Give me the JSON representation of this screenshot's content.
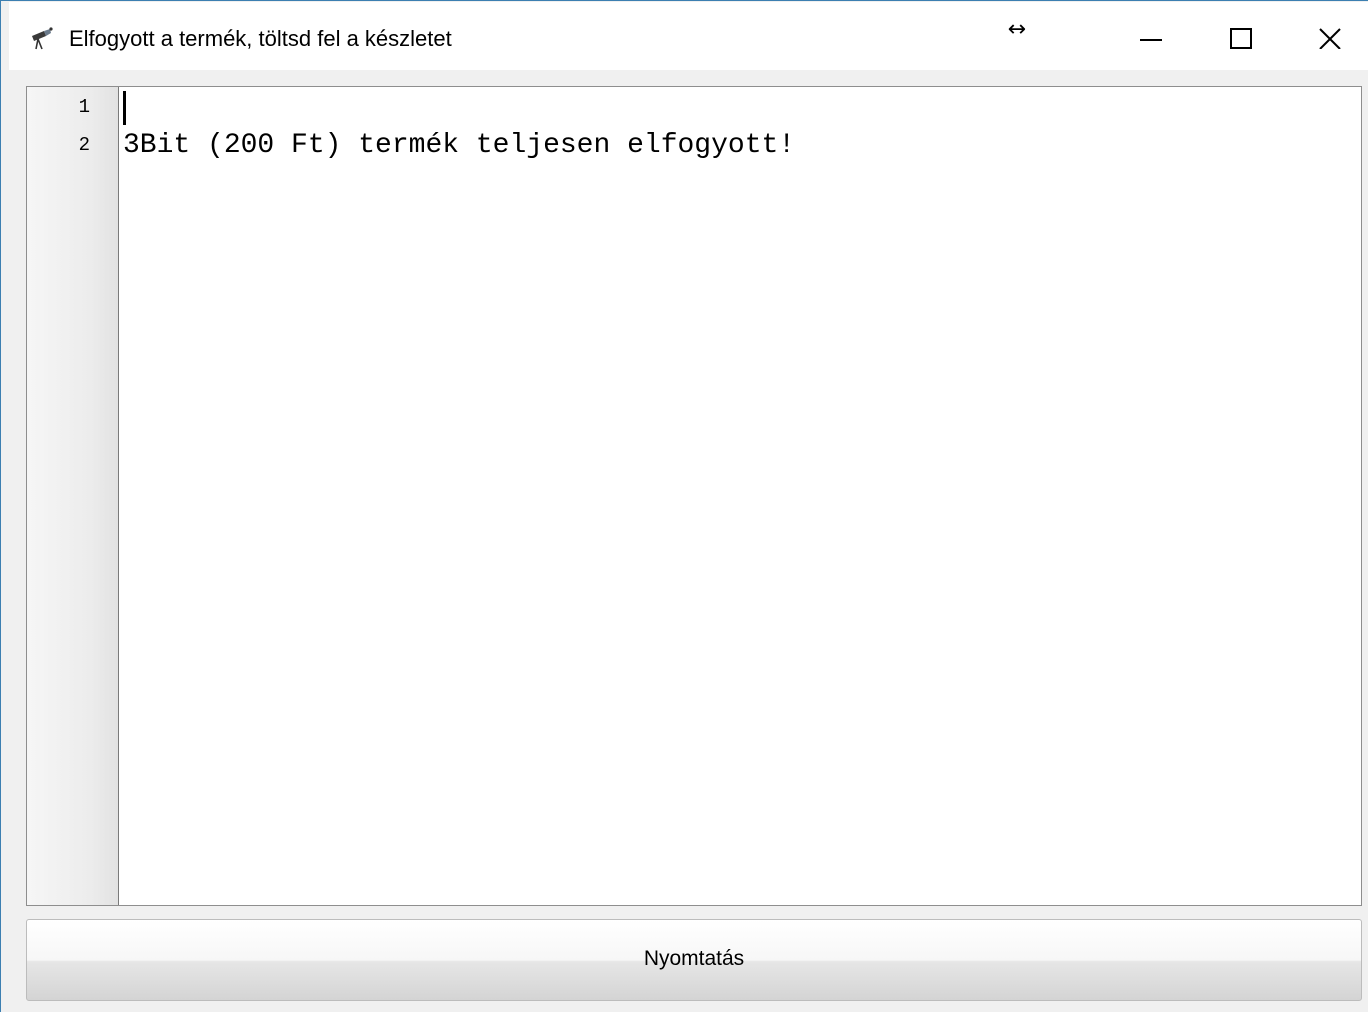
{
  "window": {
    "title": "Elfogyott a termék, töltsd fel a készletet",
    "icons": {
      "app": "telescope-app-icon",
      "resize": "horizontal-resize-cursor-icon",
      "minimize": "minimize-icon",
      "maximize": "maximize-icon",
      "close": "close-icon"
    },
    "resize_glyph": "↔"
  },
  "editor": {
    "line_numbers": [
      "1",
      "2"
    ],
    "lines": [
      "",
      "3Bit (200 Ft) termék teljesen elfogyott!"
    ]
  },
  "footer": {
    "print_label": "Nyomtatás"
  }
}
